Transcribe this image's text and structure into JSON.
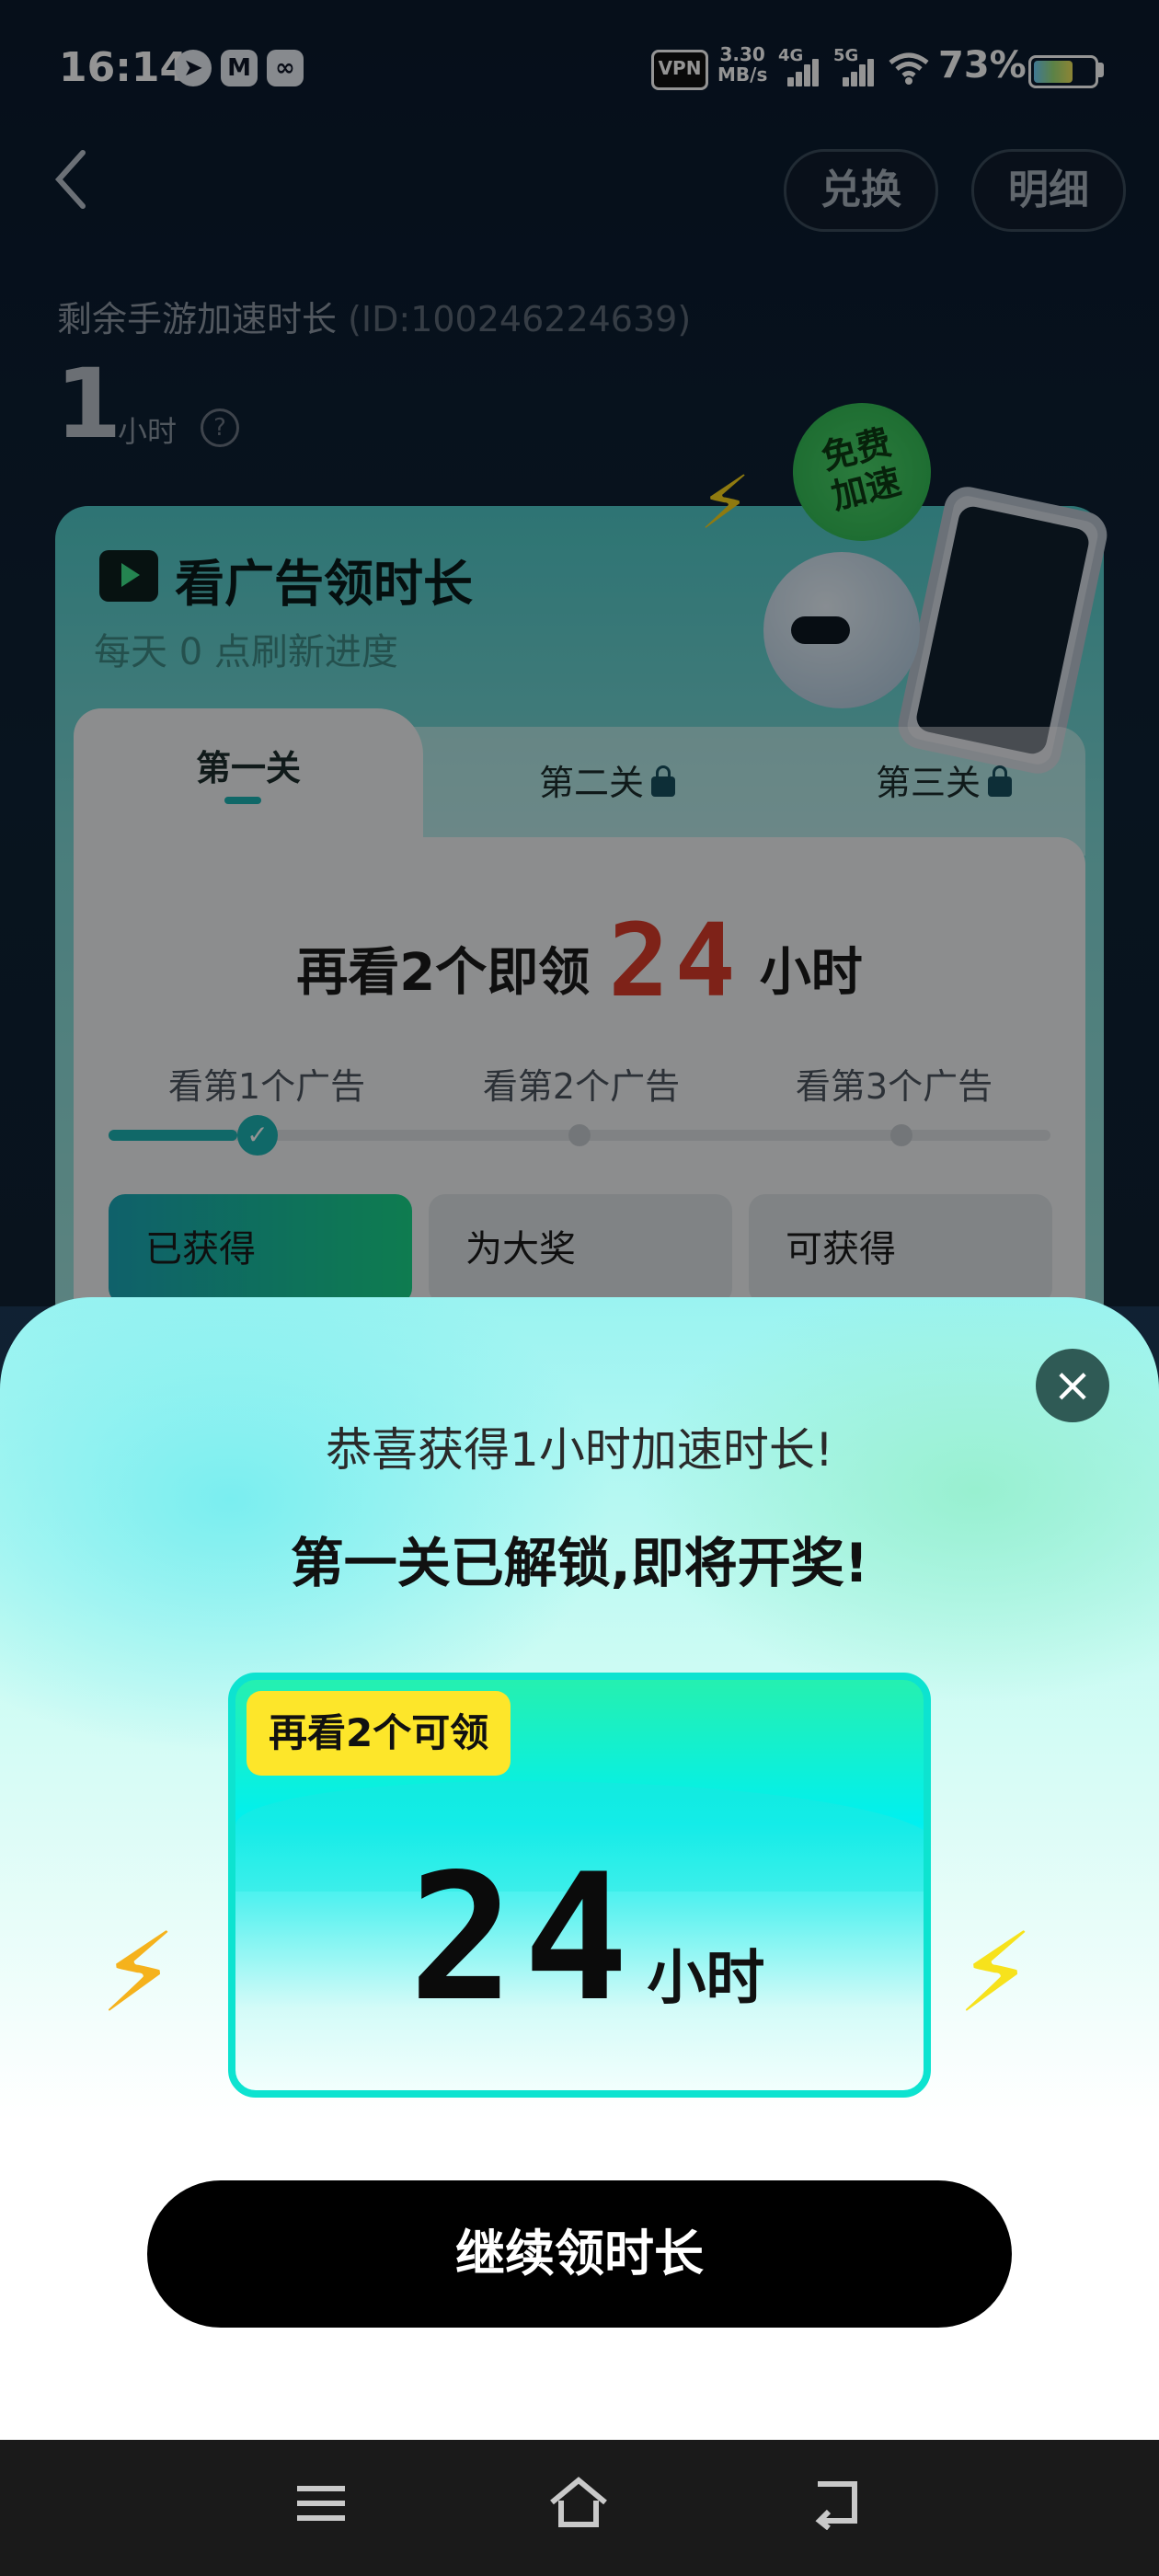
{
  "status_bar": {
    "time": "16:14",
    "app_icons": [
      "telegram-icon",
      "gmail-icon",
      "baidu-netdisk-icon"
    ],
    "vpn": "VPN",
    "net_speed_value": "3.30",
    "net_speed_unit": "MB/s",
    "sim1": "4G",
    "sim2": "5G",
    "battery": "73%",
    "battery_level": 0.73
  },
  "header": {
    "back": "<",
    "exchange_label": "兑换",
    "details_label": "明细"
  },
  "summary": {
    "remain_label": "剩余手游加速时长",
    "user_id": "(ID:100246224639)",
    "hours": "1",
    "hours_unit": "小时",
    "help": "?"
  },
  "ad_card": {
    "title": "看广告领时长",
    "subtitle": "每天 0 点刷新进度",
    "badge": "免费\n加速",
    "tabs": [
      {
        "label": "第一关",
        "active": true,
        "locked": false
      },
      {
        "label": "第二关",
        "active": false,
        "locked": true
      },
      {
        "label": "第三关",
        "active": false,
        "locked": true
      }
    ],
    "headline_prefix": "再看2个即领",
    "headline_number": "24",
    "headline_suffix": "小时",
    "steps": [
      "看第1个广告",
      "看第2个广告",
      "看第3个广告"
    ],
    "steps_completed": 1,
    "rewards": [
      "已获得",
      "为大奖",
      "可获得"
    ]
  },
  "modal": {
    "close": "×",
    "congrats": "恭喜获得1小时加速时长!",
    "unlocked": "第一关已解锁,即将开奖!",
    "reward_tag": "再看2个可领",
    "reward_number": "24",
    "reward_unit": "小时",
    "continue_label": "继续领时长"
  },
  "nav": {
    "menu_icon": "☰",
    "home_icon": "⌂",
    "back_icon": "↩"
  },
  "colors": {
    "accent_teal": "#1db3b3",
    "highlight_red": "#d93b2a",
    "tag_yellow": "#fde62a",
    "button_black": "#000000"
  }
}
